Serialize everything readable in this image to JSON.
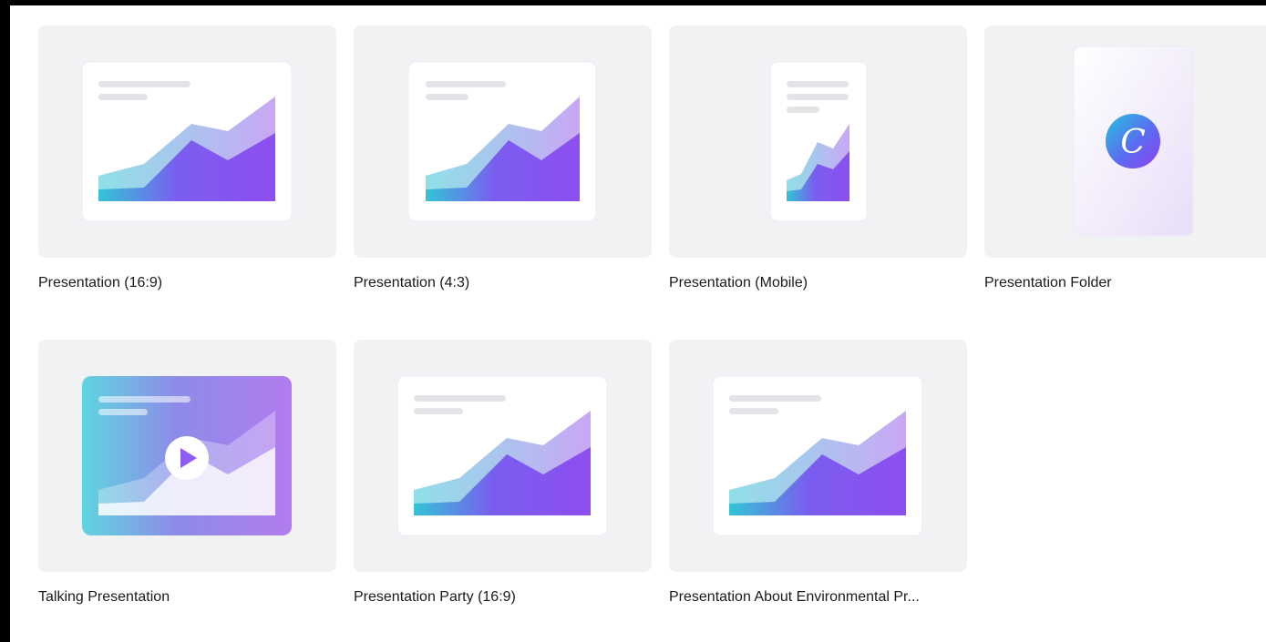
{
  "templates": [
    {
      "label": "Presentation (16:9)",
      "thumbnail": "presentation-chart-wide"
    },
    {
      "label": "Presentation (4:3)",
      "thumbnail": "presentation-chart-standard"
    },
    {
      "label": "Presentation (Mobile)",
      "thumbnail": "presentation-chart-mobile"
    },
    {
      "label": "Presentation Folder",
      "thumbnail": "canva-logo-card"
    },
    {
      "label": "Talking Presentation",
      "thumbnail": "presentation-video-play"
    },
    {
      "label": "Presentation Party (16:9)",
      "thumbnail": "presentation-chart-wide"
    },
    {
      "label": "Presentation About Environmental Pr...",
      "thumbnail": "presentation-chart-wide"
    }
  ],
  "logo_letter": "C",
  "colors": {
    "card_bg": "#f1f2f4",
    "accent_teal": "#3cc8d8",
    "accent_purple": "#8b4ef2"
  }
}
